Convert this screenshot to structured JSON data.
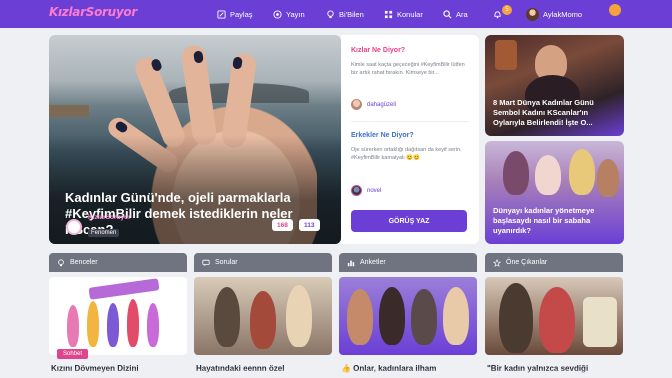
{
  "nav": {
    "logo": "KızlarSoruyor",
    "items": [
      {
        "label": "Paylaş",
        "icon": "edit-icon"
      },
      {
        "label": "Yayın",
        "icon": "broadcast-icon"
      },
      {
        "label": "Bi'Bilen",
        "icon": "bulb-icon"
      },
      {
        "label": "Konular",
        "icon": "grid-icon"
      },
      {
        "label": "Ara",
        "icon": "search-icon"
      }
    ],
    "notification_count": "5",
    "username": "AylakMomo"
  },
  "hero": {
    "title": "Kadınlar Günü'nde, ojeli parmaklarla #KeyfimBilir demek istediklerin neler KScan?",
    "author": "KızlarSoruyor",
    "author_role": "Fenomen",
    "count_a": "168",
    "count_b": "113"
  },
  "side_panel": {
    "girls_heading": "Kızlar Ne Diyor?",
    "girls_text": "Kimle saat kaçta geçeceğini #KeyfimBilir lütfen biz artık rahat bırakın. Kimseye bir...",
    "girls_user": "dahagüzeli",
    "boys_heading": "Erkekler Ne Diyor?",
    "boys_text": "Oje sürerken ortaklığı dağıtsan da keyif serin. #KeyfimBilir kamalyalı 😊😊",
    "boys_user": "novel",
    "cta_label": "GÖRÜŞ YAZ"
  },
  "right_cards": [
    {
      "caption": "8 Mart Dünya Kadınlar Günü Sembol Kadını KScanlar'ın Oylarıyla Belirlendi! İşte O..."
    },
    {
      "caption": "Dünyayı kadınlar yönetmeye başlasaydı nasıl bir sabaha uyanırdık?"
    }
  ],
  "categories": [
    {
      "label": "Benceler",
      "icon": "bulb-icon",
      "title": "Kızını Dövmeyen Dizini",
      "tag": "Sohbet"
    },
    {
      "label": "Sorular",
      "icon": "chat-icon",
      "title": "Hayatındaki eennn özel"
    },
    {
      "label": "Anketler",
      "icon": "bar-chart-icon",
      "title": "👍 Onlar, kadınlara ilham"
    },
    {
      "label": "Öne Çıkanlar",
      "icon": "star-icon",
      "title": "\"Bir kadın yalnızca sevdiği"
    }
  ],
  "colors": {
    "brand": "#6b3fd6",
    "accent": "#e0448c",
    "badge": "#f7a23a"
  }
}
